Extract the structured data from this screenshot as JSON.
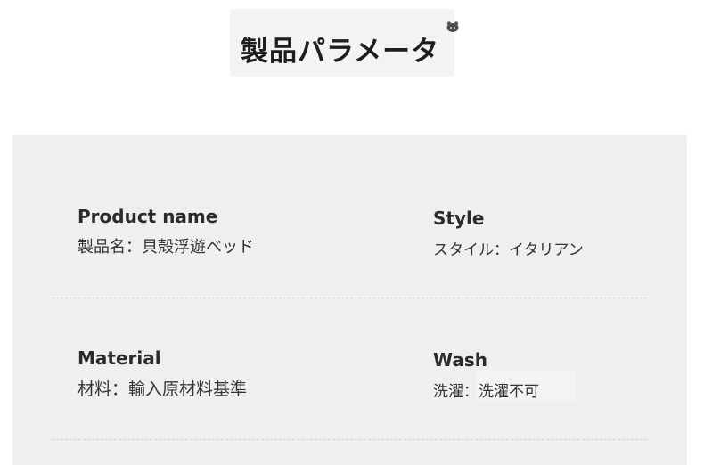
{
  "header": {
    "title": "製品パラメータ",
    "title_icon": "mascot-icon"
  },
  "params": {
    "product_name": {
      "label": "Product name",
      "value": "製品名：貝殻浮遊ベッド"
    },
    "style": {
      "label": "Style",
      "value": "スタイル：イタリアン"
    },
    "material": {
      "label": "Material",
      "value": "材料：輸入原材料基準"
    },
    "wash": {
      "label": "Wash",
      "value": "洗濯：洗濯不可"
    }
  },
  "colors": {
    "panel_bg": "#efefef",
    "title_bg": "#f3f3f3",
    "text": "#222222",
    "divider": "#d2d2d2"
  }
}
